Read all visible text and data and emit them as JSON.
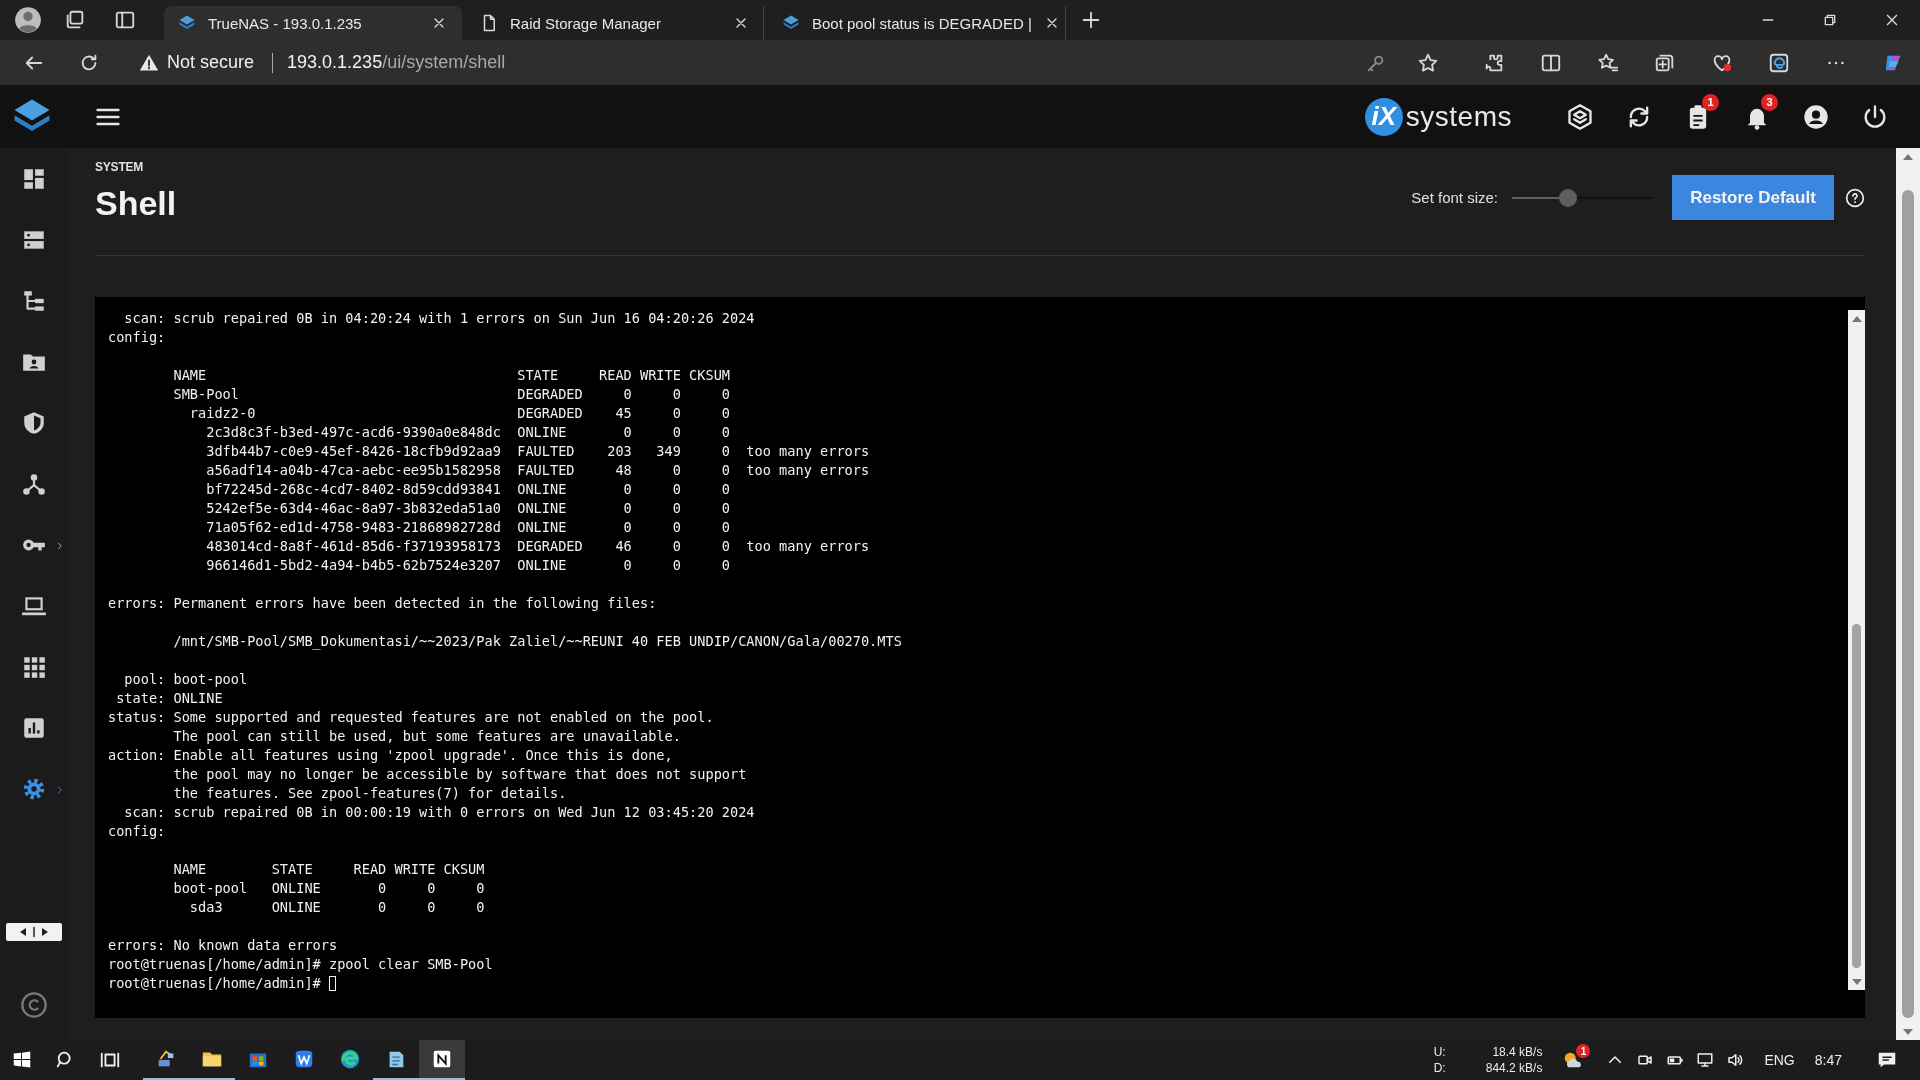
{
  "browser": {
    "tabs": [
      {
        "title": "TrueNAS - 193.0.1.235",
        "kind": "truenas",
        "selected": true
      },
      {
        "title": "Raid Storage Manager",
        "kind": "page",
        "selected": false
      },
      {
        "title": "Boot pool status is DEGRADED |",
        "kind": "truenas",
        "selected": false
      }
    ],
    "security": "Not secure",
    "url_host": "193.0.1.235",
    "url_path": "/ui/system/shell"
  },
  "header": {
    "brand_mark": "iX",
    "brand_word": "systems",
    "task_badge": "1",
    "alert_badge": "3"
  },
  "sidebar": {
    "items": [
      {
        "kind": "dashboard",
        "selected": false,
        "expandable": false
      },
      {
        "kind": "storage",
        "selected": false,
        "expandable": false
      },
      {
        "kind": "datasets",
        "selected": false,
        "expandable": false
      },
      {
        "kind": "shares",
        "selected": false,
        "expandable": false
      },
      {
        "kind": "protection",
        "selected": false,
        "expandable": false
      },
      {
        "kind": "network",
        "selected": false,
        "expandable": false
      },
      {
        "kind": "credentials",
        "selected": false,
        "expandable": true
      },
      {
        "kind": "virtualization",
        "selected": false,
        "expandable": false
      },
      {
        "kind": "apps",
        "selected": false,
        "expandable": false
      },
      {
        "kind": "reporting",
        "selected": false,
        "expandable": false
      },
      {
        "kind": "system",
        "selected": true,
        "expandable": true
      }
    ]
  },
  "page": {
    "section": "SYSTEM",
    "title": "Shell",
    "font_size_label": "Set font size:",
    "font_size": {
      "level": 0.4
    },
    "restore_button": "Restore Default"
  },
  "terminal": {
    "lines": [
      {
        "kind": "text",
        "text": "  scan: scrub repaired 0B in 04:20:24 with 1 errors on Sun Jun 16 04:20:26 2024"
      },
      {
        "kind": "text",
        "text": "config:"
      },
      {
        "kind": "blank"
      },
      {
        "kind": "row",
        "cells": [
          "NAME",
          "STATE",
          "READ",
          "WRITE",
          "CKSUM"
        ]
      },
      {
        "kind": "row",
        "cells": [
          "SMB-Pool",
          "DEGRADED",
          "0",
          "0",
          "0"
        ]
      },
      {
        "kind": "row",
        "cells": [
          "  raidz2-0",
          "DEGRADED",
          "45",
          "0",
          "0"
        ]
      },
      {
        "kind": "row",
        "cells": [
          "    2c3d8c3f-b3ed-497c-acd6-9390a0e848dc",
          "ONLINE",
          "0",
          "0",
          "0"
        ]
      },
      {
        "kind": "row",
        "cells": [
          "    3dfb44b7-c0e9-45ef-8426-18cfb9d92aa9",
          "FAULTED",
          "203",
          "349",
          "0",
          "too many errors"
        ]
      },
      {
        "kind": "row",
        "cells": [
          "    a56adf14-a04b-47ca-aebc-ee95b1582958",
          "FAULTED",
          "48",
          "0",
          "0",
          "too many errors"
        ]
      },
      {
        "kind": "row",
        "cells": [
          "    bf72245d-268c-4cd7-8402-8d59cdd93841",
          "ONLINE",
          "0",
          "0",
          "0"
        ]
      },
      {
        "kind": "row",
        "cells": [
          "    5242ef5e-63d4-46ac-8a97-3b832eda51a0",
          "ONLINE",
          "0",
          "0",
          "0"
        ]
      },
      {
        "kind": "row",
        "cells": [
          "    71a05f62-ed1d-4758-9483-21868982728d",
          "ONLINE",
          "0",
          "0",
          "0"
        ]
      },
      {
        "kind": "row",
        "cells": [
          "    483014cd-8a8f-461d-85d6-f37193958173",
          "DEGRADED",
          "46",
          "0",
          "0",
          "too many errors"
        ]
      },
      {
        "kind": "row",
        "cells": [
          "    966146d1-5bd2-4a94-b4b5-62b7524e3207",
          "ONLINE",
          "0",
          "0",
          "0"
        ]
      },
      {
        "kind": "blank"
      },
      {
        "kind": "text",
        "text": "errors: Permanent errors have been detected in the following files:"
      },
      {
        "kind": "blank"
      },
      {
        "kind": "text",
        "text": "        /mnt/SMB-Pool/SMB_Dokumentasi/~~2023/Pak Zaliel/~~REUNI 40 FEB UNDIP/CANON/Gala/00270.MTS"
      },
      {
        "kind": "blank"
      },
      {
        "kind": "text",
        "text": "  pool: boot-pool"
      },
      {
        "kind": "text",
        "text": " state: ONLINE"
      },
      {
        "kind": "text",
        "text": "status: Some supported and requested features are not enabled on the pool."
      },
      {
        "kind": "text",
        "text": "        The pool can still be used, but some features are unavailable."
      },
      {
        "kind": "text",
        "text": "action: Enable all features using 'zpool upgrade'. Once this is done,"
      },
      {
        "kind": "text",
        "text": "        the pool may no longer be accessible by software that does not support"
      },
      {
        "kind": "text",
        "text": "        the features. See zpool-features(7) for details."
      },
      {
        "kind": "text",
        "text": "  scan: scrub repaired 0B in 00:00:19 with 0 errors on Wed Jun 12 03:45:20 2024"
      },
      {
        "kind": "text",
        "text": "config:"
      },
      {
        "kind": "blank"
      },
      {
        "kind": "row",
        "cells": [
          "NAME",
          "STATE",
          "READ",
          "WRITE",
          "CKSUM"
        ]
      },
      {
        "kind": "row",
        "cells": [
          "boot-pool",
          "ONLINE",
          "0",
          "0",
          "0"
        ]
      },
      {
        "kind": "row",
        "cells": [
          "  sda3",
          "ONLINE",
          "0",
          "0",
          "0"
        ]
      },
      {
        "kind": "blank"
      },
      {
        "kind": "text",
        "text": "errors: No known data errors"
      },
      {
        "kind": "text",
        "text": "root@truenas[/home/admin]# zpool clear SMB-Pool"
      },
      {
        "kind": "prompt",
        "text": "root@truenas[/home/admin]#"
      }
    ]
  },
  "taskbar": {
    "apps": [
      {
        "kind": "network",
        "running": true,
        "selected": false
      },
      {
        "kind": "explorer",
        "running": true,
        "selected": false
      },
      {
        "kind": "store",
        "running": false,
        "selected": false
      },
      {
        "kind": "writer",
        "running": false,
        "selected": false
      },
      {
        "kind": "edge",
        "running": false,
        "selected": false
      },
      {
        "kind": "notepad",
        "running": true,
        "selected": false
      },
      {
        "kind": "notes",
        "running": true,
        "selected": true
      }
    ],
    "upload_label": "U:",
    "upload": "18.4 kB/s",
    "download_label": "D:",
    "download": "844.2 kB/s",
    "weather_badge": "1",
    "language": "ENG",
    "time": "8:47"
  }
}
